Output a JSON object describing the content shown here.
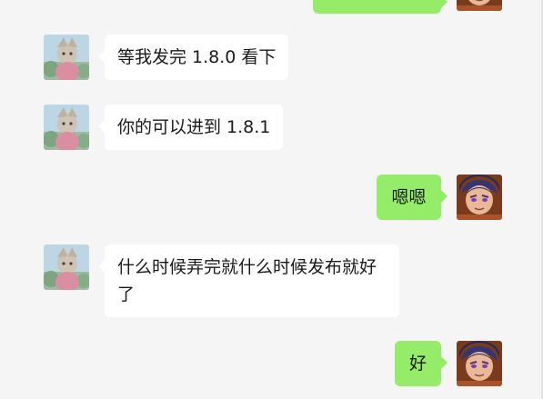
{
  "colors": {
    "background": "#f5f5f5",
    "incoming_bubble": "#ffffff",
    "outgoing_bubble": "#95ec69"
  },
  "avatars": {
    "incoming": "anime-character-avatar",
    "outgoing": "anime-character-avatar"
  },
  "messages": [
    {
      "side": "right",
      "text": ""
    },
    {
      "side": "left",
      "text": "等我发完 1.8.0 看下"
    },
    {
      "side": "left",
      "text": "你的可以进到 1.8.1"
    },
    {
      "side": "right",
      "text": "嗯嗯"
    },
    {
      "side": "left",
      "text": "什么时候弄完就什么时候发布就好了"
    },
    {
      "side": "right",
      "text": "好"
    }
  ]
}
